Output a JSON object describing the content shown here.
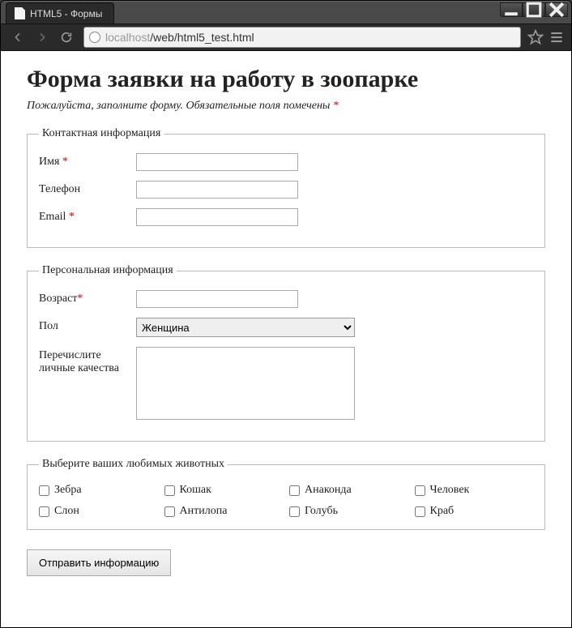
{
  "window": {
    "tab_title": "HTML5 - Формы",
    "url_grey": "localhost",
    "url_rest": "/web/html5_test.html"
  },
  "page": {
    "heading": "Форма заявки на работу в зоопарке",
    "intro_prefix": "Пожалуйста, заполните форму. Обязательные поля помечены ",
    "star": "*"
  },
  "fieldset_contact": {
    "legend": "Контактная информация",
    "name_label": "Имя ",
    "phone_label": "Телефон",
    "email_label": "Email "
  },
  "fieldset_personal": {
    "legend": "Персональная информация",
    "age_label": "Возраст",
    "gender_label": "Пол",
    "gender_value": "Женщина",
    "qualities_label": "Перечислите личные качества"
  },
  "fieldset_animals": {
    "legend": "Выберите ваших любимых животных",
    "items": [
      "Зебра",
      "Кошак",
      "Анаконда",
      "Человек",
      "Слон",
      "Антилопа",
      "Голубь",
      "Краб"
    ]
  },
  "submit_label": "Отправить информацию"
}
